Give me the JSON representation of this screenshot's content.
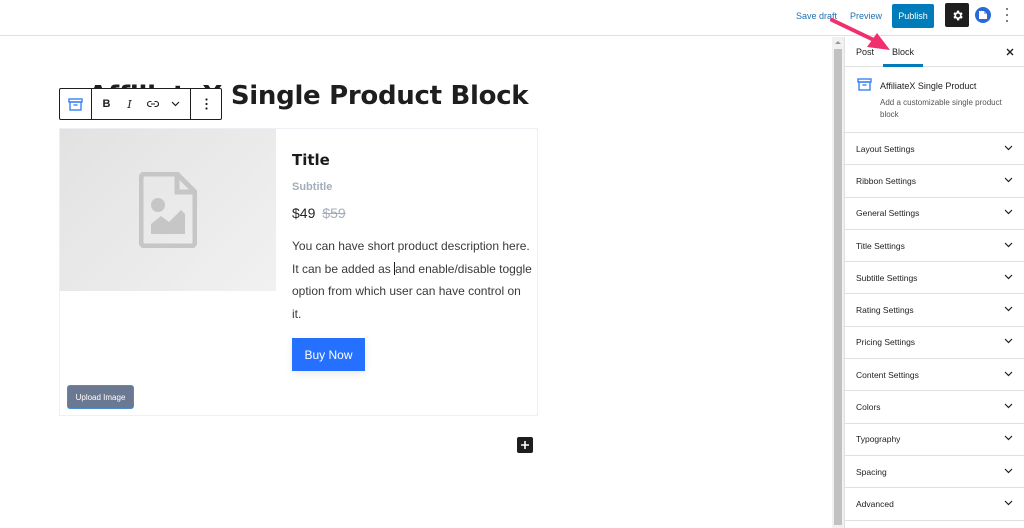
{
  "topbar": {
    "save_draft": "Save draft",
    "preview": "Preview",
    "publish": "Publish",
    "settings_icon": "gear-icon",
    "plugin_icon": "affiliatex-icon",
    "more_icon": "vertical-ellipsis-icon"
  },
  "editor": {
    "post_title": "AffiliateX Single Product Block",
    "block_toolbar": {
      "block_type_icon": "archive-box-icon",
      "bold": "B",
      "italic": "I",
      "link_icon": "link-icon",
      "more_rich_text_icon": "chevron-down-icon",
      "options_icon": "vertical-ellipsis-icon"
    },
    "product": {
      "image_placeholder_icon": "image-file-icon",
      "upload_image": "Upload Image",
      "title": "Title",
      "subtitle": "Subtitle",
      "price": "$49",
      "old_price": "$59",
      "description_before_caret": "You can have short product description here. It can be added as ",
      "description_after_caret": "and enable/disable toggle option from which user can have control on it.",
      "button": "Buy Now",
      "button_color": "#2670ff"
    },
    "add_block_icon": "plus-icon"
  },
  "sidebar": {
    "tabs": [
      {
        "label": "Post",
        "active": false
      },
      {
        "label": "Block",
        "active": true
      }
    ],
    "close_icon": "close-icon",
    "block_card": {
      "icon": "archive-box-icon",
      "title": "AffiliateX Single Product",
      "description": "Add a customizable single product block"
    },
    "panels": [
      {
        "label": "Layout Settings"
      },
      {
        "label": "Ribbon Settings"
      },
      {
        "label": "General Settings"
      },
      {
        "label": "Title Settings"
      },
      {
        "label": "Subtitle Settings"
      },
      {
        "label": "Rating Settings"
      },
      {
        "label": "Pricing Settings"
      },
      {
        "label": "Content Settings"
      },
      {
        "label": "Colors"
      },
      {
        "label": "Typography"
      },
      {
        "label": "Spacing"
      },
      {
        "label": "Advanced"
      }
    ]
  },
  "annotation": {
    "arrow_color": "#f0306e",
    "points_to": "Block"
  }
}
